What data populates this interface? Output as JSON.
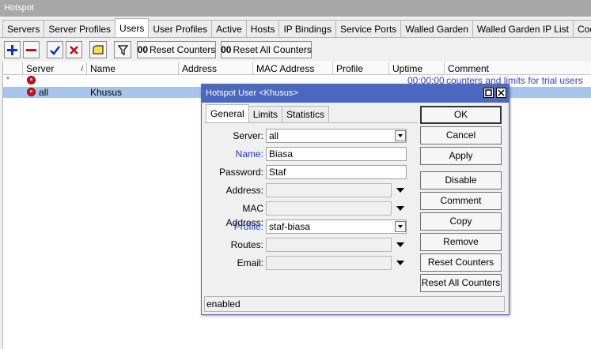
{
  "window": {
    "title": "Hotspot"
  },
  "tabs": [
    {
      "label": "Servers"
    },
    {
      "label": "Server Profiles"
    },
    {
      "label": "Users"
    },
    {
      "label": "User Profiles"
    },
    {
      "label": "Active"
    },
    {
      "label": "Hosts"
    },
    {
      "label": "IP Bindings"
    },
    {
      "label": "Service Ports"
    },
    {
      "label": "Walled Garden"
    },
    {
      "label": "Walled Garden IP List"
    },
    {
      "label": "Cookies"
    }
  ],
  "toolbar": {
    "reset_counters": {
      "prefix": "00",
      "label": "Reset Counters"
    },
    "reset_all_counters": {
      "prefix": "00",
      "label": "Reset All Counters"
    }
  },
  "table": {
    "columns": [
      "Server",
      "Name",
      "Address",
      "MAC Address",
      "Profile",
      "Uptime",
      "Comment"
    ],
    "rows": [
      {
        "marker": "*",
        "server": "",
        "name": "",
        "address": "",
        "mac": "",
        "profile": "",
        "uptime": "00:00:00",
        "comment": "counters and limits for trial users"
      },
      {
        "marker": "",
        "server": "all",
        "name": "Khusus",
        "address": "",
        "mac": "",
        "profile": "",
        "uptime": "",
        "comment": ""
      }
    ]
  },
  "dialog": {
    "title": "Hotspot User <Khusus>",
    "tabs": [
      {
        "label": "General"
      },
      {
        "label": "Limits"
      },
      {
        "label": "Statistics"
      }
    ],
    "fields": {
      "server": {
        "label": "Server:",
        "value": "all"
      },
      "name": {
        "label": "Name:",
        "value": "Biasa"
      },
      "password": {
        "label": "Password:",
        "value": "Staf"
      },
      "address": {
        "label": "Address:",
        "value": ""
      },
      "mac": {
        "label": "MAC Address:",
        "value": ""
      },
      "profile": {
        "label": "Profile:",
        "value": "staf-biasa"
      },
      "routes": {
        "label": "Routes:",
        "value": ""
      },
      "email": {
        "label": "Email:",
        "value": ""
      }
    },
    "buttons": {
      "ok": "OK",
      "cancel": "Cancel",
      "apply": "Apply",
      "disable": "Disable",
      "comment": "Comment",
      "copy": "Copy",
      "remove": "Remove",
      "reset_counters": "Reset Counters",
      "reset_all_counters": "Reset All Counters"
    },
    "status": "enabled"
  },
  "colors": {
    "accent": "#4a68c0",
    "selected_row": "#a7c5ec",
    "comment_text": "#3a3ac8",
    "label_blue": "#1a3cc8"
  }
}
